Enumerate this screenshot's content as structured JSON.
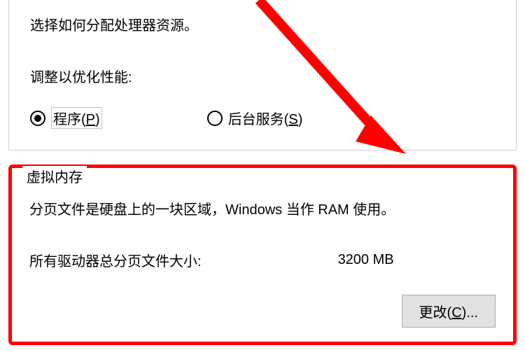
{
  "processor": {
    "description": "选择如何分配处理器资源。",
    "adjust_label": "调整以优化性能:",
    "radio_programs": "程序(",
    "radio_programs_key": "P",
    "radio_programs_end": ")",
    "radio_background": "后台服务(",
    "radio_background_key": "S",
    "radio_background_end": ")"
  },
  "virtual_memory": {
    "title": "虚拟内存",
    "description": "分页文件是硬盘上的一块区域，Windows 当作 RAM 使用。",
    "total_label": "所有驱动器总分页文件大小:",
    "total_value": "3200 MB",
    "change_button": "更改(",
    "change_button_key": "C",
    "change_button_end": ")..."
  },
  "annotation": {
    "arrow_color": "#ff0000"
  }
}
